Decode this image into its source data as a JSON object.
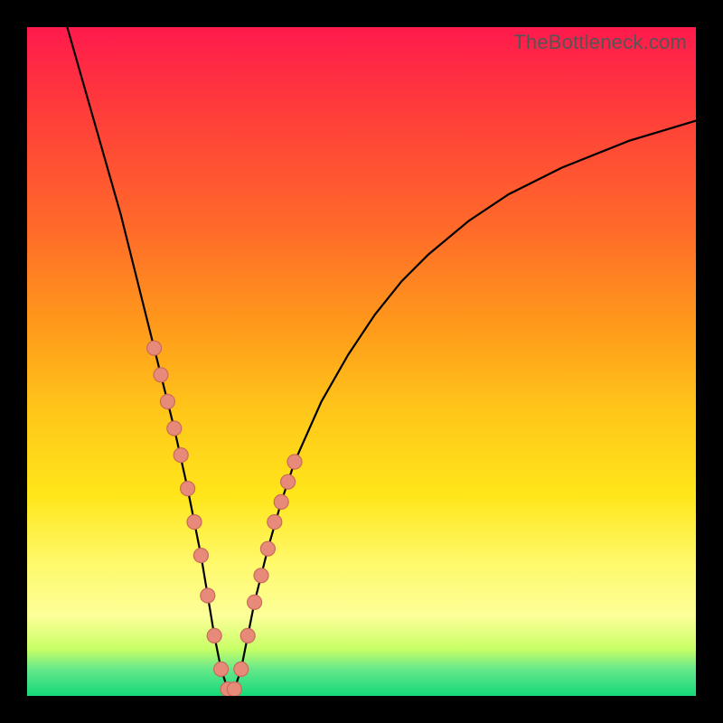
{
  "watermark": "TheBottleneck.com",
  "chart_data": {
    "type": "line",
    "title": "",
    "xlabel": "",
    "ylabel": "",
    "xlim": [
      0,
      100
    ],
    "ylim": [
      0,
      100
    ],
    "grid": false,
    "series": [
      {
        "name": "curve",
        "color": "#000000",
        "x": [
          6,
          8,
          10,
          12,
          14,
          16,
          18,
          20,
          22,
          24,
          25,
          26,
          27,
          28,
          29,
          30,
          31,
          32,
          33,
          34,
          36,
          38,
          40,
          44,
          48,
          52,
          56,
          60,
          66,
          72,
          80,
          90,
          100
        ],
        "y": [
          100,
          93,
          86,
          79,
          72,
          64,
          56,
          48,
          40,
          31,
          26,
          21,
          15,
          9,
          4,
          1,
          1,
          4,
          9,
          14,
          22,
          29,
          35,
          44,
          51,
          57,
          62,
          66,
          71,
          75,
          79,
          83,
          86
        ]
      }
    ],
    "markers": {
      "name": "highlight-dots",
      "color": "#e78a7a",
      "x": [
        19,
        20,
        21,
        22,
        23,
        24,
        25,
        26,
        27,
        28,
        29,
        30,
        31,
        32,
        33,
        34,
        35,
        36,
        37,
        38,
        39,
        40
      ],
      "y": [
        52,
        48,
        44,
        40,
        36,
        31,
        26,
        21,
        15,
        9,
        4,
        1,
        1,
        4,
        9,
        14,
        18,
        22,
        26,
        29,
        32,
        35
      ]
    }
  }
}
